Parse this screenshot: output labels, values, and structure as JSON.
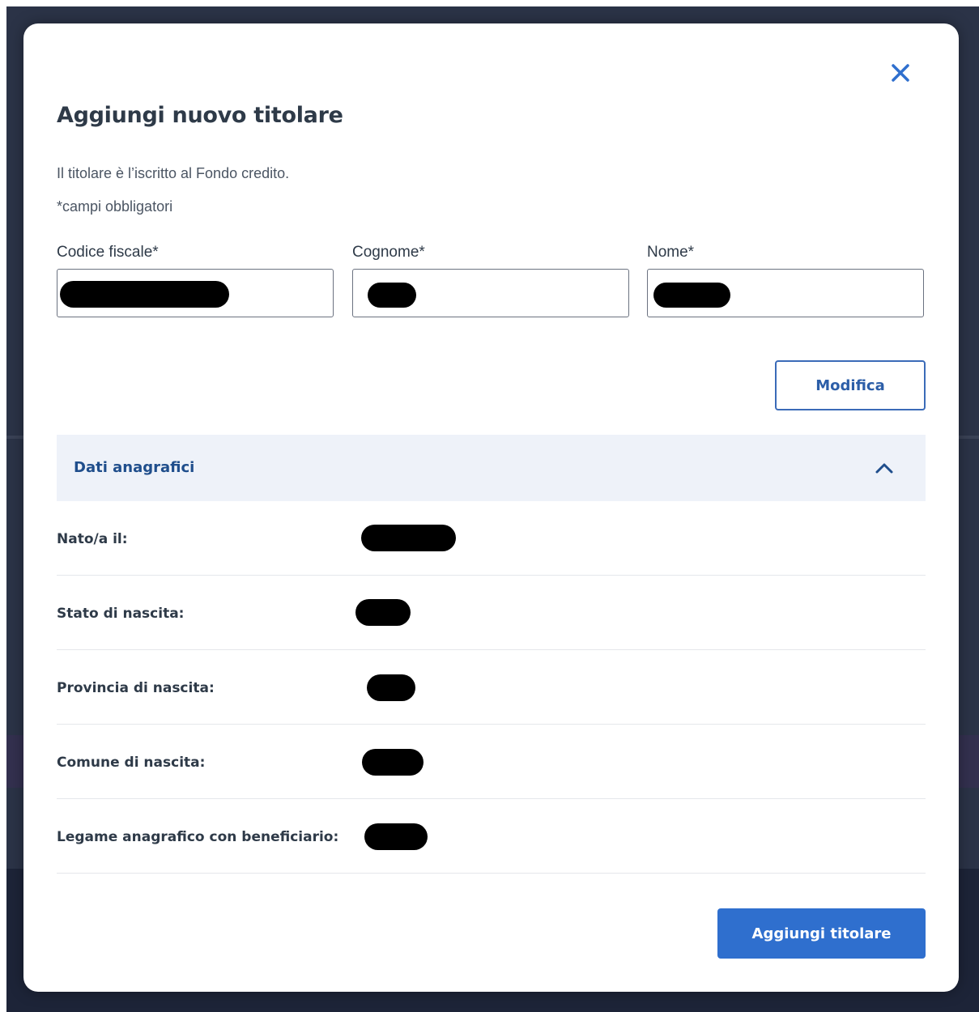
{
  "modal": {
    "title": "Aggiungi nuovo titolare",
    "description": "Il titolare è l’iscritto al Fondo credito.",
    "required_note": "*campi obbligatori",
    "close_icon": "close-icon",
    "accent_color": "#2f6fce"
  },
  "form": {
    "fields": [
      {
        "label": "Codice fiscale*",
        "value": "[redacted]"
      },
      {
        "label": "Cognome*",
        "value": "[redacted]"
      },
      {
        "label": "Nome*",
        "value": "[redacted]"
      }
    ],
    "edit_label": "Modifica"
  },
  "accordion": {
    "title": "Dati anagrafici",
    "expanded": true,
    "toggle_icon": "chevron-up-icon",
    "rows": [
      {
        "label": "Nato/a il:",
        "value": "[redacted]"
      },
      {
        "label": "Stato di nascita:",
        "value": "[redacted]"
      },
      {
        "label": "Provincia di nascita:",
        "value": "[redacted]"
      },
      {
        "label": "Comune di nascita:",
        "value": "[redacted]"
      },
      {
        "label": "Legame anagrafico con beneficiario:",
        "value": "[redacted]"
      }
    ]
  },
  "footer": {
    "submit_label": "Aggiungi titolare"
  }
}
